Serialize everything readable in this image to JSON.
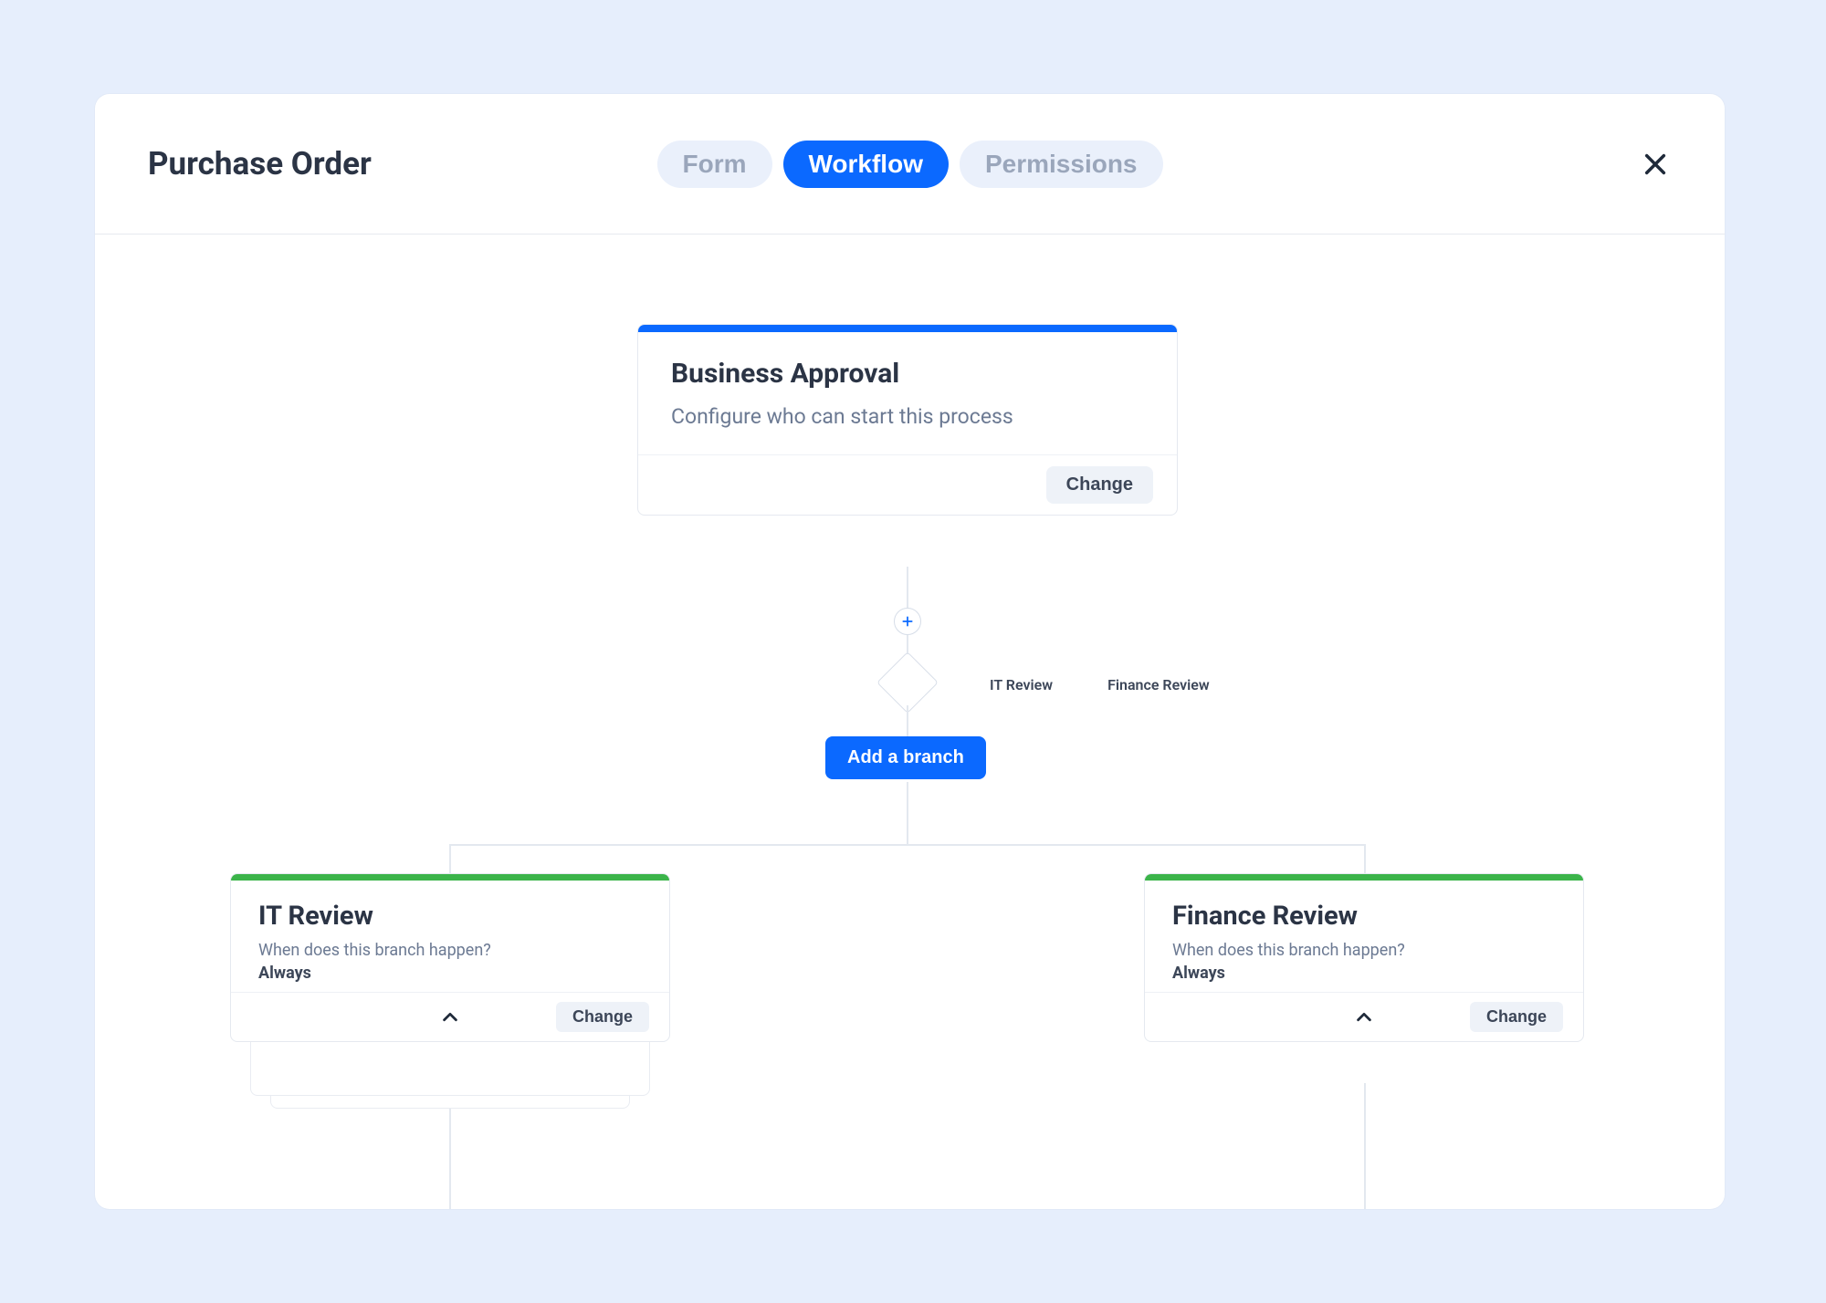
{
  "header": {
    "title": "Purchase Order",
    "tabs": [
      "Form",
      "Workflow",
      "Permissions"
    ],
    "activeTab": 1
  },
  "root": {
    "title": "Business Approval",
    "subtitle": "Configure who can start this process",
    "changeLabel": "Change"
  },
  "branchHints": [
    "IT Review",
    "Finance Review"
  ],
  "addBranchLabel": "Add a branch",
  "branches": [
    {
      "title": "IT Review",
      "questionLabel": "When does this branch happen?",
      "answer": "Always",
      "changeLabel": "Change"
    },
    {
      "title": "Finance Review",
      "questionLabel": "When does this branch happen?",
      "answer": "Always",
      "changeLabel": "Change"
    }
  ]
}
